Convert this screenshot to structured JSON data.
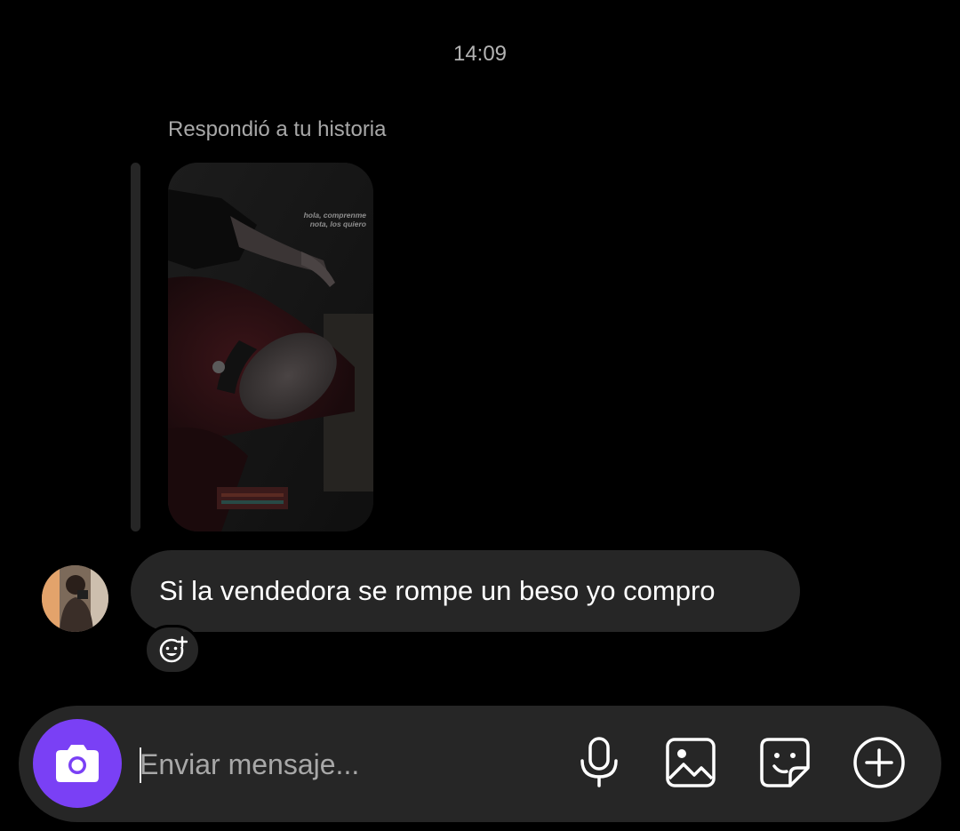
{
  "chat": {
    "timestamp": "14:09",
    "story_reply": {
      "label": "Respondió a tu historia",
      "story_caption_line1": "hola, comprenme",
      "story_caption_line2": "nota, los quiero"
    },
    "message": {
      "text": "Si la vendedora se rompe un beso yo compro"
    }
  },
  "composer": {
    "placeholder": "Enviar mensaje...",
    "value": ""
  },
  "icons": {
    "camera": "camera-icon",
    "microphone": "microphone-icon",
    "gallery": "image-gallery-icon",
    "sticker": "sticker-icon",
    "more": "plus-circle-icon",
    "reaction": "add-reaction-icon"
  },
  "colors": {
    "background": "#000000",
    "bubble": "#262626",
    "accent": "#7a40f5",
    "secondary_text": "#a8a8a8"
  }
}
